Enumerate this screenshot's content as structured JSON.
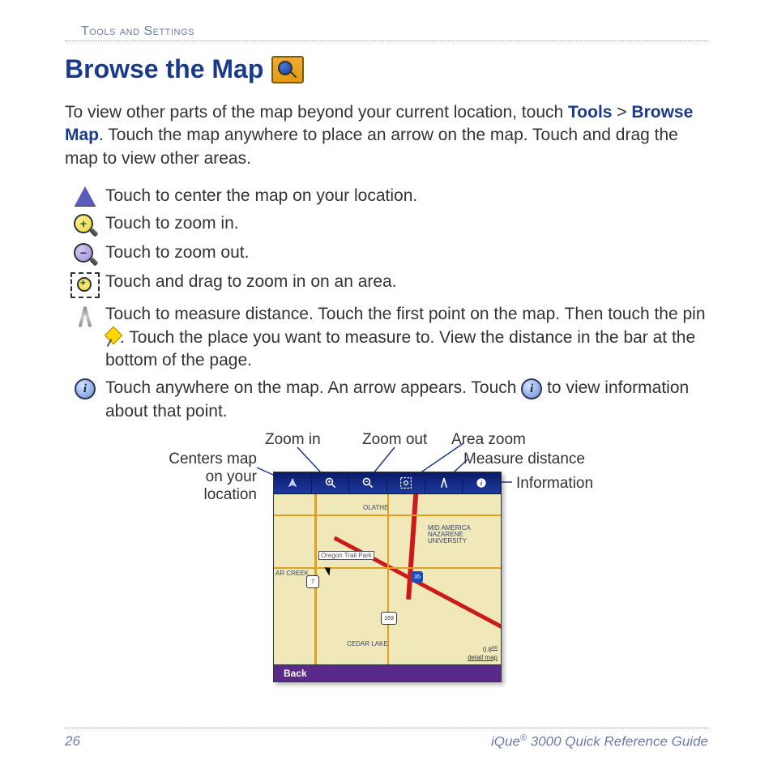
{
  "breadcrumb": "Tools and Settings",
  "title": "Browse the Map",
  "intro": {
    "a": "To view other parts of the map beyond your current location, touch ",
    "tools": "Tools",
    "sep": " > ",
    "browse": "Browse Map",
    "b": ". Touch the map anywhere to place an arrow on the map. Touch and drag the map to view other areas."
  },
  "rows": {
    "center": "Touch to center the map on your location.",
    "zoom_in": "Touch to zoom in.",
    "zoom_out": "Touch to zoom out.",
    "area_zoom": "Touch and drag to zoom in on an area.",
    "measure_a": "Touch to measure distance. Touch the first point on the map. Then touch the pin ",
    "measure_b": ". Touch the place you want to measure to. View the distance in the bar at the bottom of the page.",
    "info_a": "Touch anywhere on the map. An arrow appears. Touch ",
    "info_b": " to view information about that point."
  },
  "callouts": {
    "centers": "Centers map on your location",
    "zoom_in": "Zoom in",
    "zoom_out": "Zoom out",
    "area_zoom": "Area zoom",
    "measure": "Measure distance",
    "info": "Information"
  },
  "map": {
    "poi": "Oregon Trail Park",
    "towns": {
      "olathe": "OLATHE",
      "arcreek": "AR CREEK",
      "manu": "MID AMERICA NAZARENE UNIVERSITY",
      "cedar": "CEDAR LAKE"
    },
    "shields": {
      "r7": "7",
      "i35": "35",
      "r169": "169"
    },
    "scale_val": "0.8",
    "scale_unit": "mi",
    "detail": "detail map",
    "back": "Back"
  },
  "footer": {
    "page": "26",
    "product_a": "iQue",
    "product_sup": "®",
    "product_b": " 3000 Quick Reference Guide"
  }
}
